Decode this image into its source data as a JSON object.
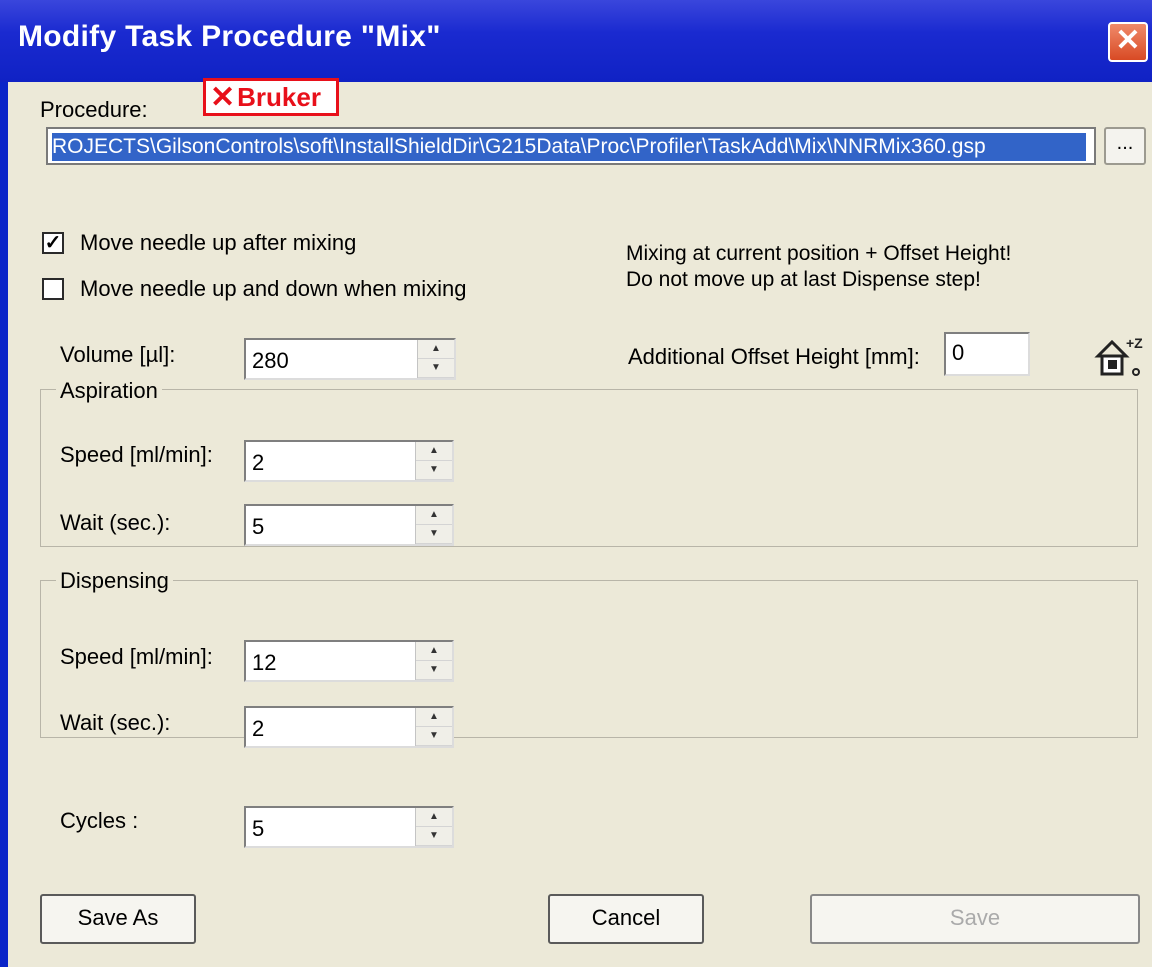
{
  "window": {
    "title": "Modify Task Procedure \"Mix\"",
    "close_label": "✕"
  },
  "procedure": {
    "label": "Procedure:",
    "logo_text": "Bruker",
    "path_value": "ROJECTS\\GilsonControls\\soft\\InstallShieldDir\\G215Data\\Proc\\Profiler\\TaskAdd\\Mix\\NNRMix360.gsp",
    "browse_label": "..."
  },
  "options": {
    "move_up_label": "Move needle up after mixing",
    "move_up_checked": true,
    "move_up_down_label": "Move needle up and down when mixing",
    "move_up_down_checked": false,
    "info_line1": "Mixing at current position + Offset Height!",
    "info_line2": "Do not move up at last Dispense step!"
  },
  "volume": {
    "label": "Volume [µl]:",
    "value": "280"
  },
  "offset": {
    "label": "Additional Offset Height [mm]:",
    "value": "0"
  },
  "aspiration": {
    "title": "Aspiration",
    "speed_label": "Speed [ml/min]:",
    "speed_value": "2",
    "wait_label": "Wait (sec.):",
    "wait_value": "5"
  },
  "dispensing": {
    "title": "Dispensing",
    "speed_label": "Speed [ml/min]:",
    "speed_value": "12",
    "wait_label": "Wait (sec.):",
    "wait_value": "2"
  },
  "cycles": {
    "label": "Cycles :",
    "value": "5"
  },
  "buttons": {
    "save_as": "Save As",
    "cancel": "Cancel",
    "save": "Save"
  },
  "icons": {
    "close": "close-icon",
    "offset": "home-offset-z-icon",
    "spin_up": "▲",
    "spin_down": "▼"
  },
  "colors": {
    "titlebar": "#1a2ad0",
    "dialog_bg": "#ece9d8",
    "selection": "#3264c8",
    "logo": "#e8101a"
  }
}
